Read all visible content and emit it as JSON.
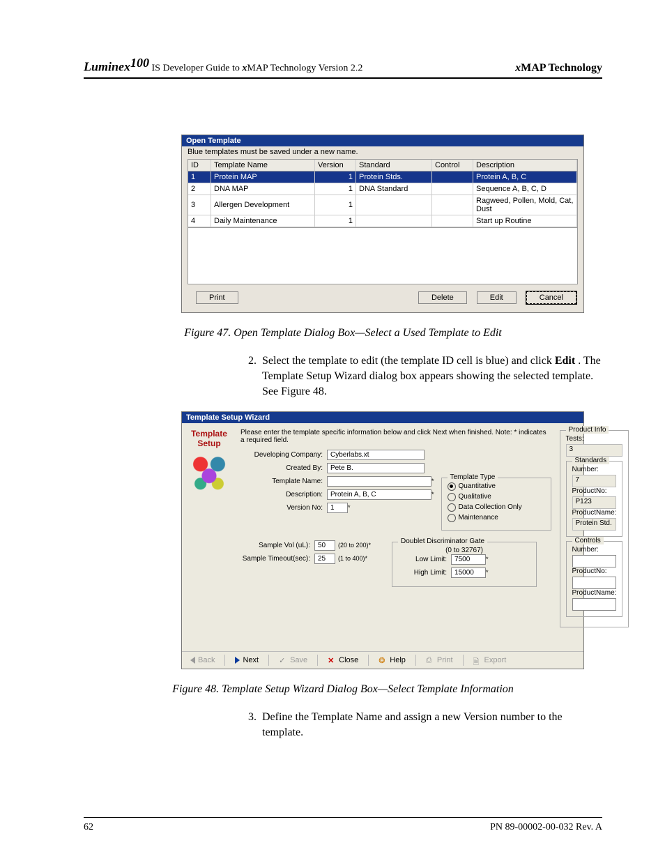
{
  "header": {
    "brand": "Luminex",
    "brand_sup": "100",
    "left_tail": " IS Developer Guide to ",
    "left_tail2": "MAP Technology Version 2.2",
    "right": "MAP  Technology",
    "x": "x"
  },
  "fig47": {
    "caption": "Figure 47.  Open Template Dialog Box—Select a Used Template to Edit",
    "title": "Open Template",
    "note": "Blue templates must be saved under a new name.",
    "cols": {
      "id": "ID",
      "name": "Template Name",
      "version": "Version",
      "standard": "Standard",
      "control": "Control",
      "desc": "Description"
    },
    "rows": [
      {
        "id": "1",
        "name": "Protein MAP",
        "version": "1",
        "standard": "Protein Stds.",
        "control": "",
        "desc": "Protein A, B, C"
      },
      {
        "id": "2",
        "name": "DNA MAP",
        "version": "1",
        "standard": "DNA Standard",
        "control": "",
        "desc": "Sequence A, B, C, D"
      },
      {
        "id": "3",
        "name": "Allergen Development",
        "version": "1",
        "standard": "",
        "control": "",
        "desc": "Ragweed, Pollen, Mold, Cat, Dust"
      },
      {
        "id": "4",
        "name": "Daily Maintenance",
        "version": "1",
        "standard": "",
        "control": "",
        "desc": "Start up Routine"
      }
    ],
    "buttons": {
      "print": "Print",
      "delete": "Delete",
      "edit": "Edit",
      "cancel": "Cancel"
    }
  },
  "step2": {
    "num": "2.",
    "text_a": "Select the template to edit (the template ID cell is blue) and click ",
    "text_bold": "Edit",
    "text_b": ". The Template Setup Wizard dialog box appears showing the selected template. See Figure 48."
  },
  "fig48": {
    "caption": "Figure 48.  Template Setup Wizard Dialog Box—Select Template Information",
    "title": "Template Setup Wizard",
    "side_title": "Template Setup",
    "instr": "Please enter the template specific information below and click Next when finished.  Note: * indicates a required field.",
    "labels": {
      "dev_company": "Developing Company:",
      "created_by": "Created By:",
      "template_name": "Template Name:",
      "description": "Description:",
      "version_no": "Version No:",
      "sample_vol": "Sample Vol (uL):",
      "sample_timeout": "Sample Timeout(sec):",
      "low_limit": "Low Limit:",
      "high_limit": "High Limit:"
    },
    "values": {
      "dev_company": "Cyberlabs.xt",
      "created_by": "Pete B.",
      "template_name": "",
      "description": "Protein A, B, C",
      "version_no": "1",
      "sample_vol": "50",
      "sample_vol_hint": "(20 to 200)",
      "sample_timeout": "25",
      "sample_timeout_hint": "(1 to 400)",
      "low_limit": "7500",
      "high_limit": "15000",
      "dd_range": "(0 to 32767)"
    },
    "template_type": {
      "legend": "Template Type",
      "quant": "Quantitative",
      "qual": "Qualitative",
      "data": "Data Collection Only",
      "maint": "Maintenance"
    },
    "dd_legend": "Doublet Discriminator Gate",
    "product_info": {
      "legend": "Product Info",
      "tests": "Tests:",
      "tests_v": "3",
      "std_legend": "Standards",
      "number": "Number:",
      "std_n": "7",
      "productno": "ProductNo:",
      "productno_v": "P123",
      "productname": "ProductName:",
      "productname_v": "Protein Std.",
      "ctrl_legend": "Controls",
      "ctrl_n": "",
      "ctrl_pno": "",
      "ctrl_pname": ""
    },
    "toolbar": {
      "back": "Back",
      "next": "Next",
      "save": "Save",
      "close": "Close",
      "help": "Help",
      "print": "Print",
      "export": "Export"
    }
  },
  "step3": {
    "num": "3.",
    "text": "Define the Template Name and assign a new Version number to the template."
  },
  "footer": {
    "page": "62",
    "pn": "PN 89-00002-00-032 Rev. A"
  }
}
